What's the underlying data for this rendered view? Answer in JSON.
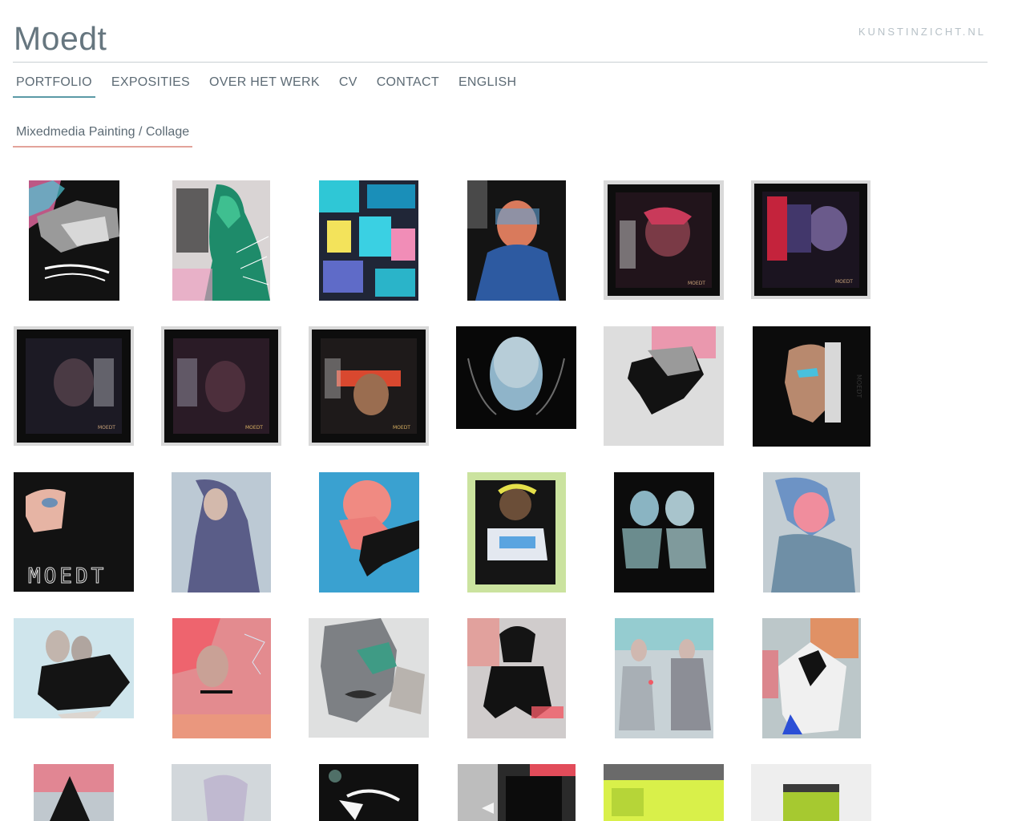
{
  "header": {
    "site_title": "Moedt",
    "external_link": "KUNSTINZICHT.NL"
  },
  "nav": {
    "items": [
      {
        "label": "PORTFOLIO",
        "active": true
      },
      {
        "label": "EXPOSITIES"
      },
      {
        "label": "OVER HET WERK"
      },
      {
        "label": "CV"
      },
      {
        "label": "CONTACT"
      },
      {
        "label": "ENGLISH"
      }
    ]
  },
  "subnav": {
    "active_label": "Mixedmedia Painting / Collage"
  },
  "gallery": {
    "artworks": [
      {
        "kind": "collage-profile-black",
        "signature": ""
      },
      {
        "kind": "green-figure-light",
        "signature": ""
      },
      {
        "kind": "abstract-blue",
        "signature": ""
      },
      {
        "kind": "dark-blue-portrait",
        "signature": ""
      },
      {
        "kind": "framed-dark-red",
        "signature": "MOEDT"
      },
      {
        "kind": "framed-dark-purple",
        "signature": "MOEDT"
      },
      {
        "kind": "framed-dark-face",
        "signature": "MOEDT"
      },
      {
        "kind": "framed-dark-face2",
        "signature": "MOEDT"
      },
      {
        "kind": "framed-red-eyes",
        "signature": "MOEDT"
      },
      {
        "kind": "blue-head-hands",
        "signature": ""
      },
      {
        "kind": "collage-profile-pink",
        "signature": ""
      },
      {
        "kind": "portrait-cut-black",
        "signature": "MOEDT"
      },
      {
        "kind": "eye-collage-black",
        "signature": "MOEDT"
      },
      {
        "kind": "hooded-woman-blue",
        "signature": ""
      },
      {
        "kind": "crouching-pink-blue",
        "signature": ""
      },
      {
        "kind": "boy-neon",
        "signature": ""
      },
      {
        "kind": "two-heads-black",
        "signature": ""
      },
      {
        "kind": "man-pink-head",
        "signature": ""
      },
      {
        "kind": "two-women-black",
        "signature": ""
      },
      {
        "kind": "woman-red-lines",
        "signature": ""
      },
      {
        "kind": "lips-collage",
        "signature": ""
      },
      {
        "kind": "crouching-dark-woman",
        "signature": ""
      },
      {
        "kind": "ghostly-couple",
        "signature": ""
      },
      {
        "kind": "abstract-figure-white",
        "signature": ""
      },
      {
        "kind": "pink-cone",
        "signature": ""
      },
      {
        "kind": "pale-sketch",
        "signature": ""
      },
      {
        "kind": "arrow-black",
        "signature": ""
      },
      {
        "kind": "architectural-black",
        "signature": ""
      },
      {
        "kind": "neon-green-window",
        "signature": ""
      },
      {
        "kind": "neon-green-small",
        "signature": ""
      }
    ]
  }
}
